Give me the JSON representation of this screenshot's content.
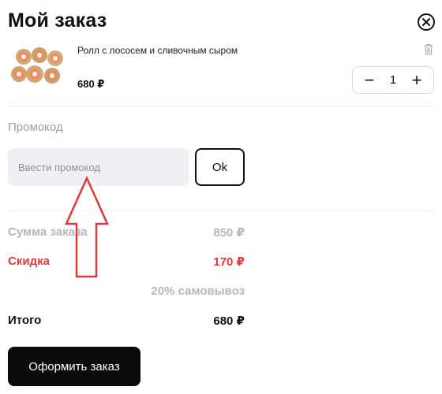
{
  "header": {
    "title": "Мой заказ",
    "close_icon": "close-circle-icon"
  },
  "cart": {
    "item": {
      "name": "Ролл с лососем и сливочным сыром",
      "price": "680 ₽",
      "quantity": "1",
      "image": "sushi-rolls-image",
      "delete_icon": "trash-icon"
    },
    "stepper": {
      "minus": "−",
      "plus": "+"
    }
  },
  "promo": {
    "label": "Промокод",
    "placeholder": "Ввести промокод",
    "value": "",
    "button": "Ok"
  },
  "summary": {
    "subtotal_label": "Сумма заказа",
    "subtotal_value": "850 ₽",
    "discount_label": "Скидка",
    "discount_value": "170 ₽",
    "discount_note": "20% самовывоз",
    "total_label": "Итого",
    "total_value": "680 ₽"
  },
  "checkout": {
    "label": "Оформить заказ"
  },
  "annotation": {
    "arrow_icon": "red-arrow-up-icon",
    "color": "#e0383e"
  },
  "colors": {
    "accent": "#e0383e",
    "button": "#0b0b0b",
    "input_bg": "#eef0f4",
    "muted": "#b4b8be"
  }
}
